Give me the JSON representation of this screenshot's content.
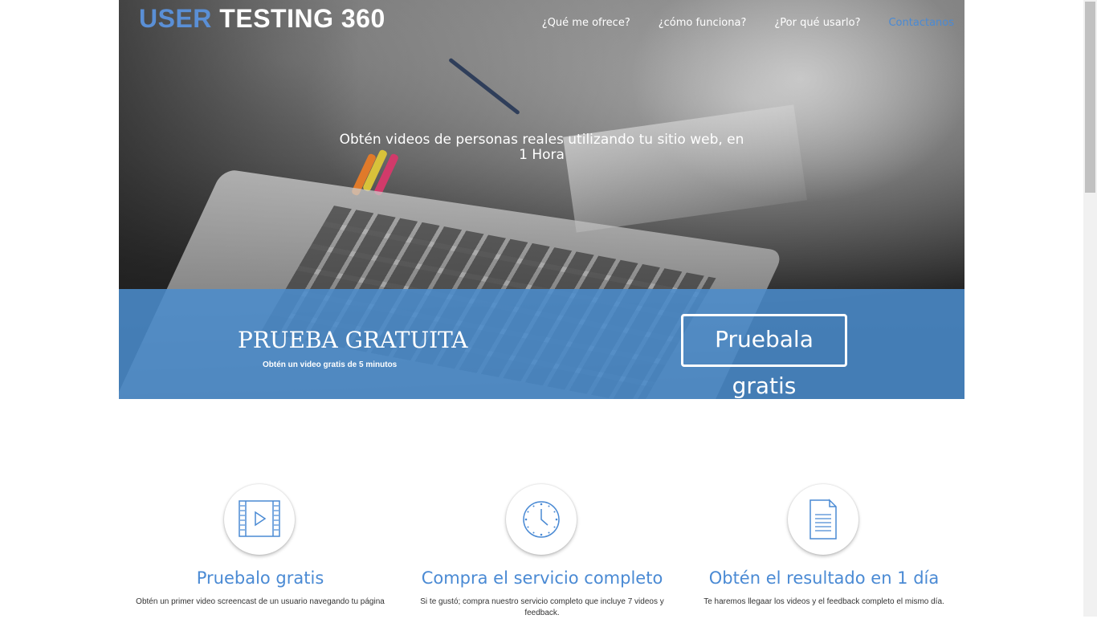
{
  "header": {
    "logo_part1": "USER",
    "logo_part2": "TESTING 360",
    "nav": [
      {
        "label": "¿Qué me ofrece?"
      },
      {
        "label": "¿cómo funciona?"
      },
      {
        "label": "¿Por qué usarlo?"
      },
      {
        "label": "Contactanos"
      }
    ]
  },
  "hero": {
    "headline": "Obtén videos de personas reales utilizando tu sitio web, en 1 Hora"
  },
  "promo": {
    "title": "PRUEBA GRATUITA",
    "subtitle": "Obtén un video gratis de 5 minutos",
    "button": "Pruebala gratis"
  },
  "features": [
    {
      "icon": "video-file-icon",
      "title": "Pruebalo gratis",
      "text": "Obtén un primer video screencast de un usuario navegando tu página"
    },
    {
      "icon": "clock-icon",
      "title": "Compra el servicio completo",
      "text": "Si te gustó; compra nuestro servicio completo que incluye 7 videos y feedback."
    },
    {
      "icon": "document-icon",
      "title": "Obtén el resultado en 1 día",
      "text": "Te haremos llegaar los videos y el feedback completo el mismo día."
    }
  ],
  "colors": {
    "accent": "#4a8ad4",
    "promo_band": "#4a8dce"
  }
}
